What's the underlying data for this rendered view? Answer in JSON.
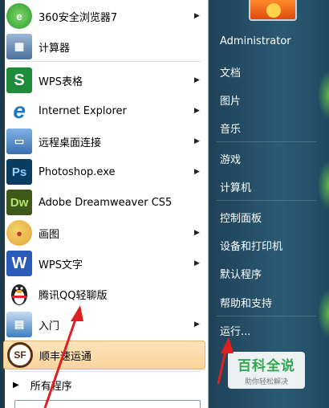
{
  "programs": [
    {
      "label": "360安全浏览器7",
      "has_arrow": true,
      "icon": "360-browser-icon",
      "color": "#3cae3c"
    },
    {
      "label": "计算器",
      "has_arrow": false,
      "icon": "calculator-icon",
      "color": "#4b6f9a"
    },
    {
      "label": "WPS表格",
      "has_arrow": true,
      "icon": "wps-spreadsheet-icon",
      "color": "#1e8c3a"
    },
    {
      "label": "Internet Explorer",
      "has_arrow": true,
      "icon": "internet-explorer-icon",
      "color": "#1b78c8"
    },
    {
      "label": "远程桌面连接",
      "has_arrow": true,
      "icon": "remote-desktop-icon",
      "color": "#3a6fb0"
    },
    {
      "label": "Photoshop.exe",
      "has_arrow": true,
      "icon": "photoshop-icon",
      "color": "#0b3d63"
    },
    {
      "label": "Adobe Dreamweaver CS5",
      "has_arrow": false,
      "icon": "dreamweaver-icon",
      "color": "#3d5a1a"
    },
    {
      "label": "画图",
      "has_arrow": true,
      "icon": "paint-icon",
      "color": "#e6a23a"
    },
    {
      "label": "WPS文字",
      "has_arrow": true,
      "icon": "wps-writer-icon",
      "color": "#2a5bb8"
    },
    {
      "label": "腾讯QQ轻聊版",
      "has_arrow": false,
      "icon": "qq-penguin-icon",
      "color": "#222222"
    },
    {
      "label": "入门",
      "has_arrow": true,
      "icon": "getting-started-icon",
      "color": "#3c7fc2"
    },
    {
      "label": "顺丰速运通",
      "has_arrow": false,
      "icon": "sf-express-icon",
      "color": "#5a2d10"
    }
  ],
  "all_programs": "所有程序",
  "right_items": [
    "Administrator",
    "文档",
    "图片",
    "音乐",
    "游戏",
    "计算机",
    "控制面板",
    "设备和打印机",
    "默认程序",
    "帮助和支持",
    "运行..."
  ],
  "watermark": {
    "title": "百科全说",
    "subtitle": "助你轻松解决"
  },
  "colors": {
    "accent_selected": "#fbd49b",
    "annotation": "#e02020",
    "right_pane": "#2a5a73"
  }
}
